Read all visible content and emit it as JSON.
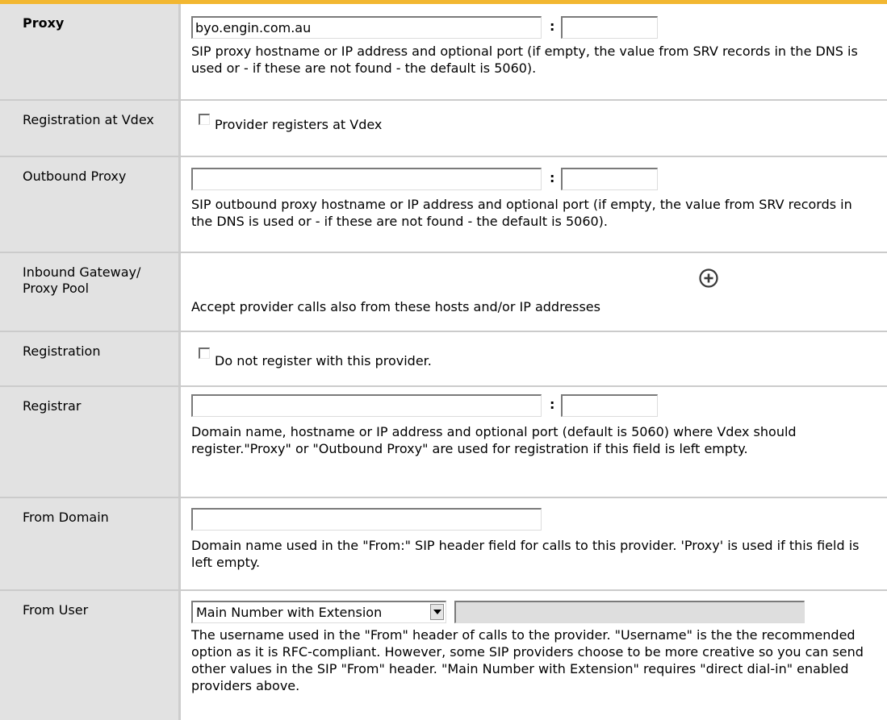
{
  "proxy": {
    "label": "Proxy",
    "host_value": "byo.engin.com.au",
    "port_value": "",
    "separator": ":",
    "description": "SIP proxy hostname or IP address and optional port (if empty, the value from SRV records in the DNS is used or - if these are not found - the default is 5060)."
  },
  "registration_at": {
    "label": "Registration at Vdex",
    "checkbox_label": "Provider registers at Vdex",
    "checked": false
  },
  "outbound_proxy": {
    "label": "Outbound Proxy",
    "host_value": "",
    "port_value": "",
    "separator": ":",
    "description": "SIP outbound proxy hostname or IP address and optional port (if empty, the value from SRV records in the DNS is used or - if these are not found - the default is 5060)."
  },
  "inbound_gateway": {
    "label": "Inbound Gateway/ Proxy Pool",
    "add_icon": "plus-circle-icon",
    "description": "Accept provider calls also from these hosts and/or IP addresses"
  },
  "registration": {
    "label": "Registration",
    "checkbox_label": "Do not register with this provider.",
    "checked": false
  },
  "registrar": {
    "label": "Registrar",
    "host_value": "",
    "port_value": "",
    "separator": ":",
    "description": "Domain name, hostname or IP address and optional port (default is 5060) where Vdex should register.\"Proxy\" or \"Outbound Proxy\" are used for registration if this field is left empty."
  },
  "from_domain": {
    "label": "From Domain",
    "value": "",
    "description": "Domain name used in the \"From:\" SIP header field for calls to this provider. 'Proxy' is used if this field is left empty."
  },
  "from_user": {
    "label": "From User",
    "selected_option": "Main Number with Extension",
    "text_value": "",
    "description": "The username used in the \"From\" header of calls to the provider. \"Username\" is the the recommended option as it is RFC-compliant. However, some SIP providers choose to be more creative so you can send other values in the SIP \"From\" header. \"Main Number with Extension\" requires \"direct dial-in\" enabled providers above."
  },
  "colors": {
    "accent_bar": "#f2b731",
    "label_bg": "#e2e2e2",
    "divider": "#cbcbcb"
  }
}
